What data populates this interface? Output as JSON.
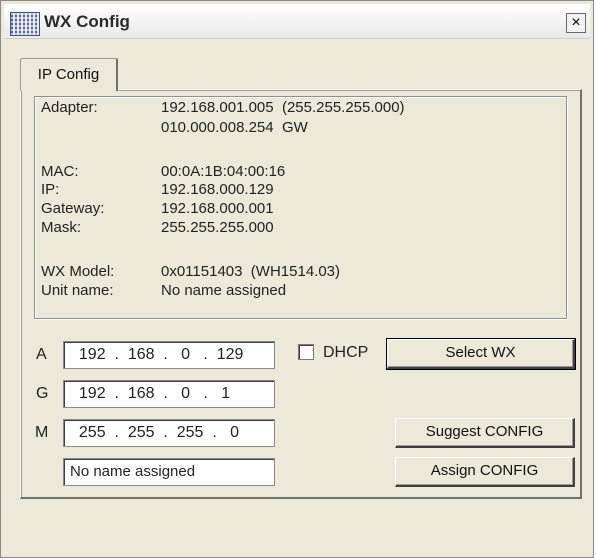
{
  "window": {
    "title": "WX Config",
    "close_label": "×"
  },
  "tabs": [
    {
      "label": "IP Config"
    }
  ],
  "info": {
    "adapter_label": "Adapter:",
    "adapter_value": "192.168.001.005  (255.255.255.000)",
    "adapter_gw": "010.000.008.254  GW",
    "mac_label": "MAC:",
    "mac_value": "00:0A:1B:04:00:16",
    "ip_label": "IP:",
    "ip_value": "192.168.000.129",
    "gateway_label": "Gateway:",
    "gateway_value": "192.168.000.001",
    "mask_label": "Mask:",
    "mask_value": "255.255.255.000",
    "model_label": "WX Model:",
    "model_value": "0x01151403  (WH1514.03)",
    "unit_label": "Unit name:",
    "unit_value": "No name assigned"
  },
  "form": {
    "address_label": "A",
    "address_value": "  192  .  168  .   0   .  129",
    "gateway_label": "G",
    "gateway_value": "  192  .  168  .   0   .   1",
    "mask_label": "M",
    "mask_value": "  255  .  255  .  255  .   0",
    "name_value": "No name assigned",
    "dhcp_label": "DHCP",
    "dhcp_checked": false
  },
  "buttons": {
    "select": "Select WX",
    "suggest": "Suggest CONFIG",
    "assign": "Assign CONFIG"
  }
}
